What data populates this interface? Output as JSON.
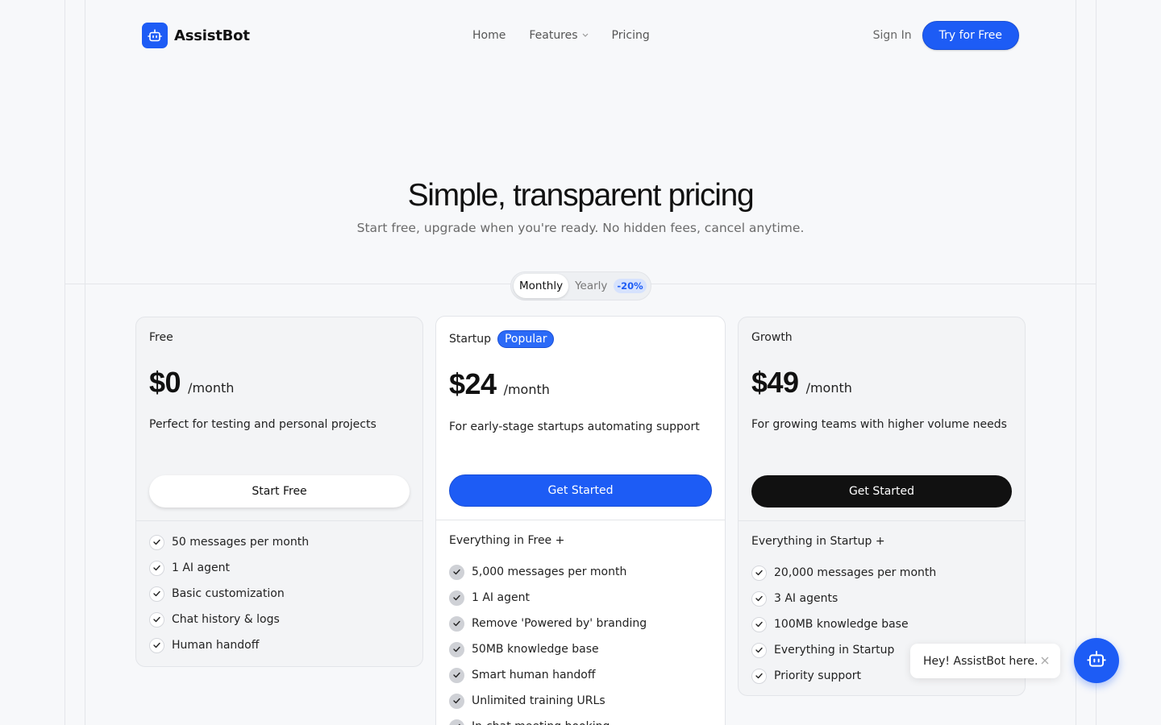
{
  "brand": {
    "name": "AssistBot",
    "logo_icon": "robot-icon",
    "accent": "#1d5cf5"
  },
  "nav": {
    "items": [
      {
        "label": "Home"
      },
      {
        "label": "Features",
        "has_dropdown": true
      },
      {
        "label": "Pricing"
      }
    ],
    "sign_in": "Sign In",
    "cta": "Try for Free"
  },
  "hero": {
    "title": "Simple, transparent pricing",
    "subtitle": "Start free, upgrade when you're ready. No hidden fees, cancel anytime."
  },
  "billing_toggle": {
    "monthly": "Monthly",
    "yearly": "Yearly",
    "discount": "-20%",
    "selected": "Monthly"
  },
  "plans": [
    {
      "name": "Free",
      "price": "$0",
      "period": "/month",
      "description": "Perfect for testing and personal projects",
      "cta": "Start Free",
      "features_heading": "",
      "features": [
        "50 messages per month",
        "1 AI agent",
        "Basic customization",
        "Chat history & logs",
        "Human handoff"
      ]
    },
    {
      "name": "Startup",
      "badge": "Popular",
      "price": "$24",
      "period": "/month",
      "description": "For early-stage startups automating support",
      "cta": "Get Started",
      "features_heading": "Everything in Free +",
      "features": [
        "5,000 messages per month",
        "1 AI agent",
        "Remove 'Powered by' branding",
        "50MB knowledge base",
        "Smart human handoff",
        "Unlimited training URLs",
        "In-chat meeting booking"
      ]
    },
    {
      "name": "Growth",
      "price": "$49",
      "period": "/month",
      "description": "For growing teams with higher volume needs",
      "cta": "Get Started",
      "features_heading": "Everything in Startup +",
      "features": [
        "20,000 messages per month",
        "3 AI agents",
        "100MB knowledge base",
        "Everything in Startup",
        "Priority support"
      ]
    }
  ],
  "chat_widget": {
    "greeting": "Hey! AssistBot here.",
    "close_icon": "close-icon",
    "launcher_icon": "robot-icon"
  }
}
